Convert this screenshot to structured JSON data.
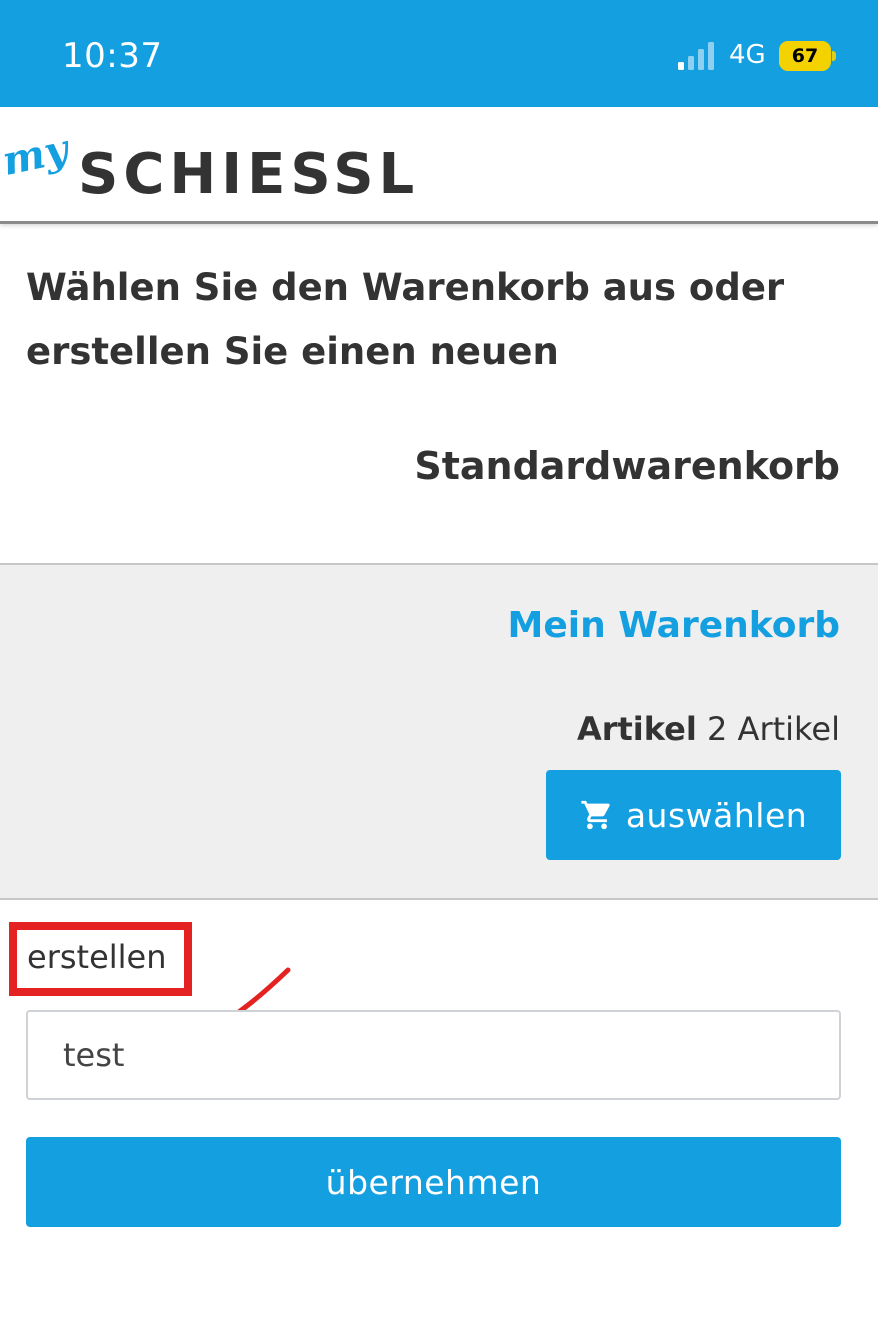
{
  "status_bar": {
    "time": "10:37",
    "network": "4G",
    "battery": "67",
    "signal_icon": "signal-bars-icon",
    "battery_color": "#f4d100"
  },
  "header": {
    "logo_prefix": "my",
    "logo_text": "SCHIESSL"
  },
  "page": {
    "heading": "Wählen Sie den Warenkorb aus oder erstellen Sie einen neuen"
  },
  "cart": {
    "name": "Standardwarenkorb",
    "title": "Mein Warenkorb",
    "items_label": "Artikel",
    "items_value": "2 Artikel",
    "select_label": "auswählen",
    "select_icon": "cart-icon"
  },
  "create": {
    "label": "erstellen",
    "input_value": "test",
    "submit_label": "übernehmen"
  },
  "colors": {
    "accent": "#139fe0",
    "annotation": "#e52222",
    "text": "#333333",
    "panel": "#efefef"
  }
}
